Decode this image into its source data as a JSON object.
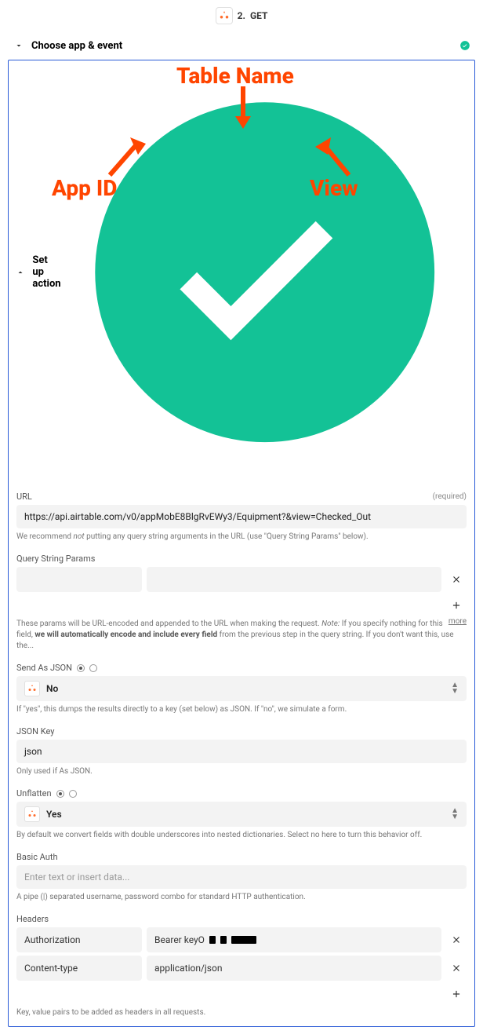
{
  "step": {
    "number": "2.",
    "name": "GET"
  },
  "sections": {
    "choose": "Choose app & event",
    "setup": "Set up action"
  },
  "url": {
    "label": "URL",
    "required": "(required)",
    "value": "https://api.airtable.com/v0/appMobE8BlgRvEWy3/Equipment?&view=Checked_Out",
    "help_prefix": "We recommend ",
    "help_not": "not",
    "help_suffix": " putting any query string arguments in the URL (use \"Query String Params\" below)."
  },
  "query_params": {
    "label": "Query String Params",
    "help_prefix": "These params will be URL-encoded and appended to the URL when making the request. ",
    "help_note_label": "Note:",
    "help_note_text": " If you specify nothing for this field, ",
    "help_bold": "we will automatically encode and include every field",
    "help_suffix": " from the previous step in the query string. If you don't want this, use the...",
    "more": "more"
  },
  "send_json": {
    "label": "Send As JSON",
    "value": "No",
    "help": "If \"yes\", this dumps the results directly to a key (set below) as JSON. If \"no\", we simulate a form."
  },
  "json_key": {
    "label": "JSON Key",
    "value": "json",
    "help": "Only used if As JSON."
  },
  "unflatten": {
    "label": "Unflatten",
    "value": "Yes",
    "help": "By default we convert fields with double underscores into nested dictionaries. Select no here to turn this behavior off."
  },
  "basic_auth": {
    "label": "Basic Auth",
    "placeholder": "Enter text or insert data...",
    "help": "A pipe (|) separated username, password combo for standard HTTP authentication."
  },
  "headers": {
    "label": "Headers",
    "rows": [
      {
        "key": "Authorization",
        "value": "Bearer keyO"
      },
      {
        "key": "Content-type",
        "value": "application/json"
      }
    ],
    "help": "Key, value pairs to be added as headers in all requests."
  },
  "annotations": {
    "table_name": "Table Name",
    "app_id": "App ID",
    "view": "View"
  }
}
